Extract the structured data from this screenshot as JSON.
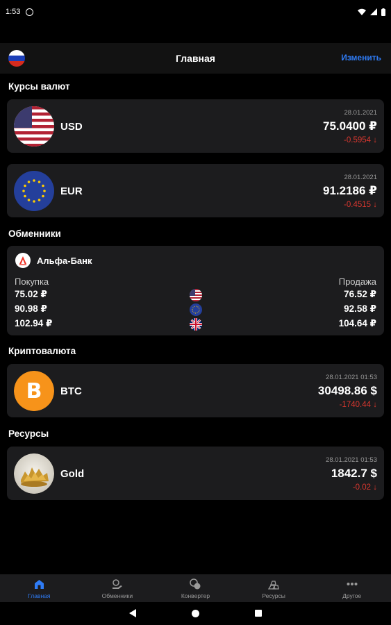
{
  "status": {
    "time": "1:53"
  },
  "header": {
    "title": "Главная",
    "edit_label": "Изменить"
  },
  "sections": {
    "rates": "Курсы валют",
    "exchangers": "Обменники",
    "crypto": "Криптовалюта",
    "resources": "Ресурсы"
  },
  "currencies": [
    {
      "code": "USD",
      "date": "28.01.2021",
      "value": "75.0400 ₽",
      "delta": "-0.5954 ↓"
    },
    {
      "code": "EUR",
      "date": "28.01.2021",
      "value": "91.2186 ₽",
      "delta": "-0.4515 ↓"
    }
  ],
  "exchanger": {
    "bank_name": "Альфа-Банк",
    "logo_letter": "A",
    "buy_label": "Покупка",
    "sell_label": "Продажа",
    "rows": [
      {
        "buy": "75.02 ₽",
        "sell": "76.52 ₽",
        "flag": "usd-flag-icon"
      },
      {
        "buy": "90.98 ₽",
        "sell": "92.58 ₽",
        "flag": "eur-flag-icon"
      },
      {
        "buy": "102.94 ₽",
        "sell": "104.64 ₽",
        "flag": "gbp-flag-icon"
      }
    ]
  },
  "crypto": {
    "code": "BTC",
    "date": "28.01.2021 01:53",
    "value": "30498.86 $",
    "delta": "-1740.44 ↓",
    "symbol": "B"
  },
  "resource": {
    "code": "Gold",
    "date": "28.01.2021 01:53",
    "value": "1842.7 $",
    "delta": "-0.02 ↓"
  },
  "tabs": [
    {
      "label": "Главная",
      "icon": "home-icon",
      "active": true
    },
    {
      "label": "Обменники",
      "icon": "exchange-icon",
      "active": false
    },
    {
      "label": "Конвертер",
      "icon": "converter-icon",
      "active": false
    },
    {
      "label": "Ресурсы",
      "icon": "resources-icon",
      "active": false
    },
    {
      "label": "Другое",
      "icon": "more-icon",
      "active": false
    }
  ],
  "colors": {
    "accent": "#2f7cf6",
    "negative": "#d9372f",
    "card": "#1c1c1e",
    "bitcoin": "#f7931a",
    "alfa": "#ef3124"
  }
}
